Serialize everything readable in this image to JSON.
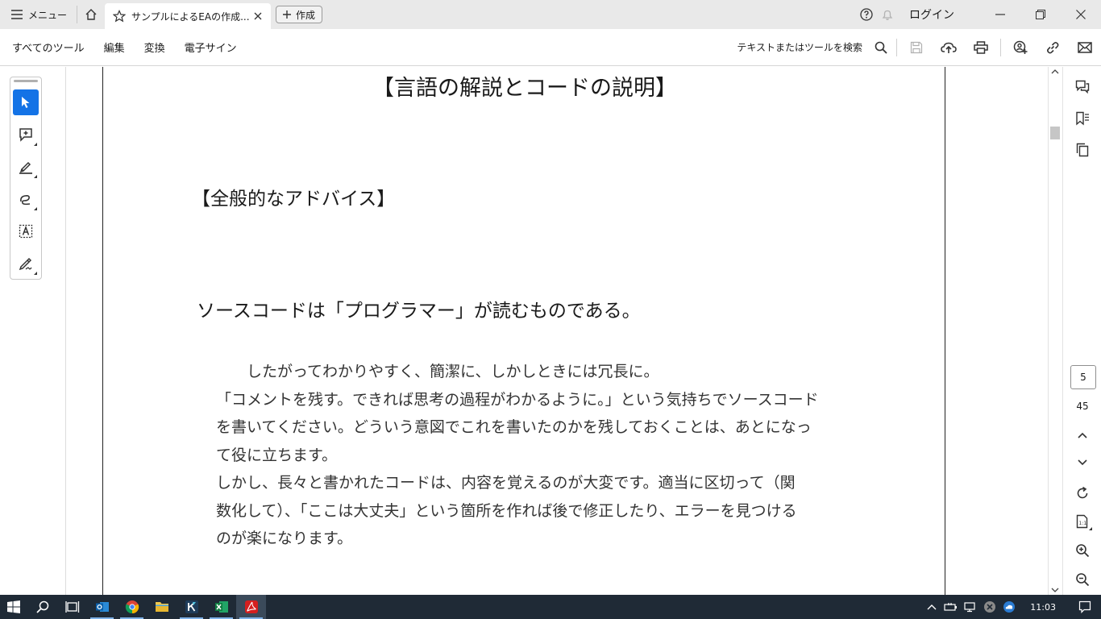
{
  "titlebar": {
    "menu_label": "メニュー",
    "tab_title": "サンプルによるEAの作成...",
    "create_label": "作成",
    "login_label": "ログイン"
  },
  "toolbar": {
    "menus": [
      "すべてのツール",
      "編集",
      "変換",
      "電子サイン"
    ],
    "search_label": "テキストまたはツールを検索"
  },
  "document": {
    "title": "【言語の解説とコードの説明】",
    "heading": "【全般的なアドバイス】",
    "subheading": "ソースコードは「プログラマー」が読むものである。",
    "body_lines": [
      "　　したがってわかりやすく、簡潔に、しかしときには冗長に。",
      "「コメントを残す。できれば思考の過程がわかるように。」という気持ちでソースコード",
      "を書いてください。どういう意図でこれを書いたのかを残しておくことは、あとになっ",
      "て役に立ちます。",
      "しかし、長々と書かれたコードは、内容を覚えるのが大変です。適当に区切って（関",
      "数化して）、「ここは大丈夫」という箇所を作れば後で修正したり、エラーを見つける",
      "のが楽になります。"
    ]
  },
  "navigation": {
    "current_page": "5",
    "total_pages": "45"
  },
  "taskbar": {
    "clock": "11:03"
  },
  "colors": {
    "accent": "#1473e6",
    "taskbar": "#1f2a36",
    "titlebar": "#e9e9e9"
  }
}
